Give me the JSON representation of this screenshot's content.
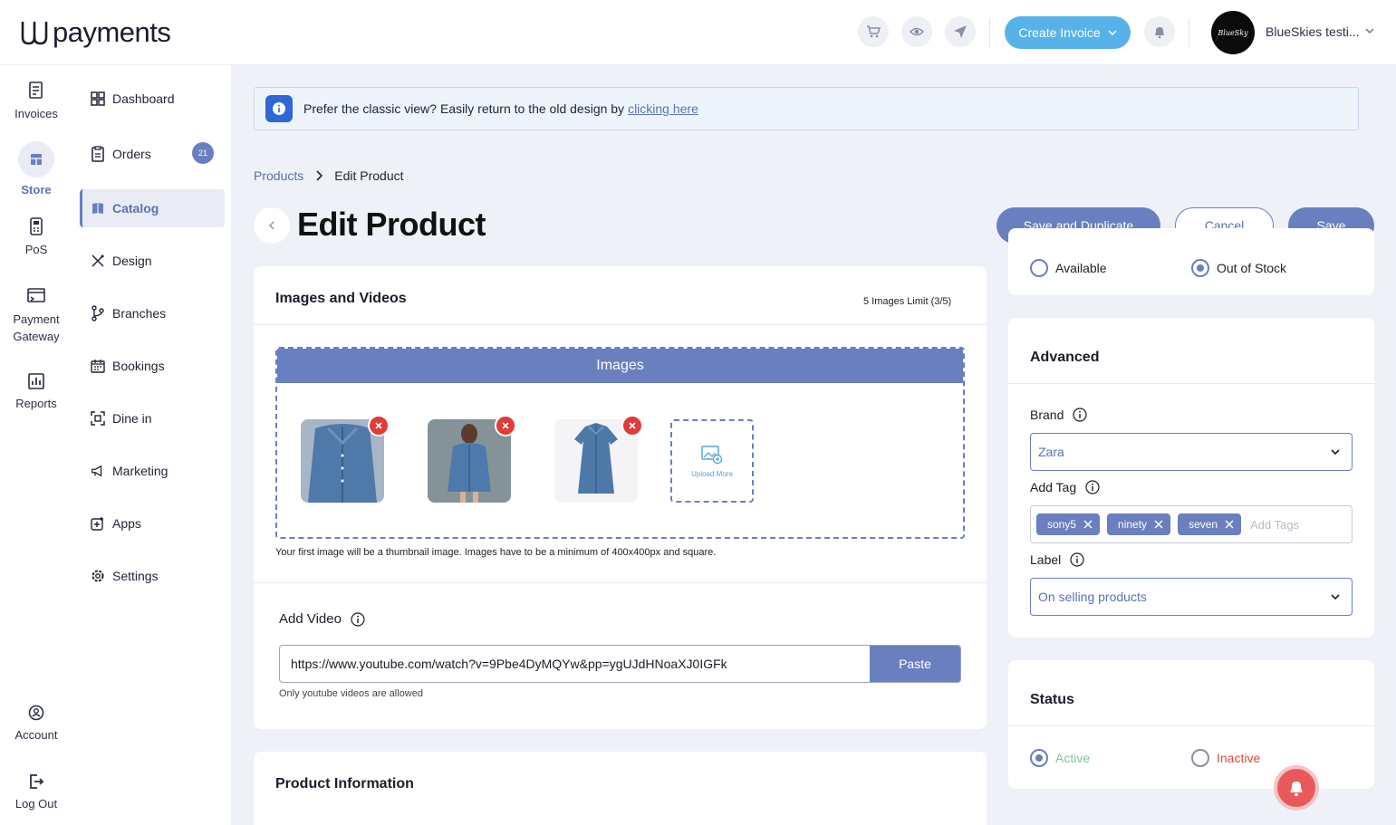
{
  "brand": {
    "logo_text": "payments"
  },
  "topbar": {
    "cart_icon": "cart-icon",
    "preview_icon": "eye-icon",
    "send_icon": "send-icon",
    "create_invoice_label": "Create Invoice",
    "bell_icon": "bell-icon",
    "avatar_text": "BlueSky",
    "account_name": "BlueSkies testi..."
  },
  "rail": {
    "items": [
      {
        "label": "Invoices",
        "icon": "invoice-icon"
      },
      {
        "label": "Store",
        "icon": "store-icon",
        "active": true
      },
      {
        "label": "PoS",
        "icon": "pos-icon"
      },
      {
        "label": "Payment Gateway",
        "icon": "payment-gateway-icon"
      },
      {
        "label": "Reports",
        "icon": "reports-icon"
      }
    ],
    "bottom": [
      {
        "label": "Account",
        "icon": "account-icon"
      },
      {
        "label": "Log Out",
        "icon": "logout-icon"
      }
    ]
  },
  "subnav": {
    "items": [
      {
        "label": "Dashboard",
        "icon": "dashboard-icon"
      },
      {
        "label": "Orders",
        "icon": "orders-icon",
        "badge": "21"
      },
      {
        "label": "Catalog",
        "icon": "catalog-icon",
        "active": true
      },
      {
        "label": "Design",
        "icon": "design-icon"
      },
      {
        "label": "Branches",
        "icon": "branches-icon"
      },
      {
        "label": "Bookings",
        "icon": "bookings-icon"
      },
      {
        "label": "Dine in",
        "icon": "dine-in-icon"
      },
      {
        "label": "Marketing",
        "icon": "marketing-icon"
      },
      {
        "label": "Apps",
        "icon": "apps-icon"
      },
      {
        "label": "Settings",
        "icon": "settings-icon"
      }
    ]
  },
  "banner": {
    "text": "Prefer the classic view? Easily return to the old design by",
    "link": "clicking here"
  },
  "breadcrumb": {
    "parent": "Products",
    "current": "Edit Product"
  },
  "page": {
    "title": "Edit Product"
  },
  "actions": {
    "save_duplicate": "Save and Duplicate",
    "cancel": "Cancel",
    "save": "Save"
  },
  "media": {
    "title": "Images and Videos",
    "limit": "5 Images Limit (3/5)",
    "images_header": "Images",
    "upload_more": "Upload More",
    "hint": "Your first image will be a thumbnail image. Images have to be a minimum of 400x400px and square.",
    "video_label": "Add Video",
    "video_value": "https://www.youtube.com/watch?v=9Pbe4DyMQYw&pp=ygUJdHNoaXJ0IGFk",
    "paste": "Paste",
    "video_hint": "Only youtube videos are allowed"
  },
  "product_info": {
    "title": "Product Information"
  },
  "stock": {
    "available": "Available",
    "out_of_stock": "Out of Stock"
  },
  "advanced": {
    "title": "Advanced",
    "brand_label": "Brand",
    "brand_value": "Zara",
    "tag_label": "Add Tag",
    "tags": [
      "sony5",
      "ninety",
      "seven"
    ],
    "tag_placeholder": "Add Tags",
    "label_label": "Label",
    "label_value": "On selling products"
  },
  "status": {
    "title": "Status",
    "active": "Active",
    "inactive": "Inactive"
  },
  "colors": {
    "accent": "#6a7fbf",
    "create_button": "#58b2ea",
    "danger": "#e23b3b",
    "active_green": "#7fc99a",
    "inactive_red": "#d94a3a"
  }
}
